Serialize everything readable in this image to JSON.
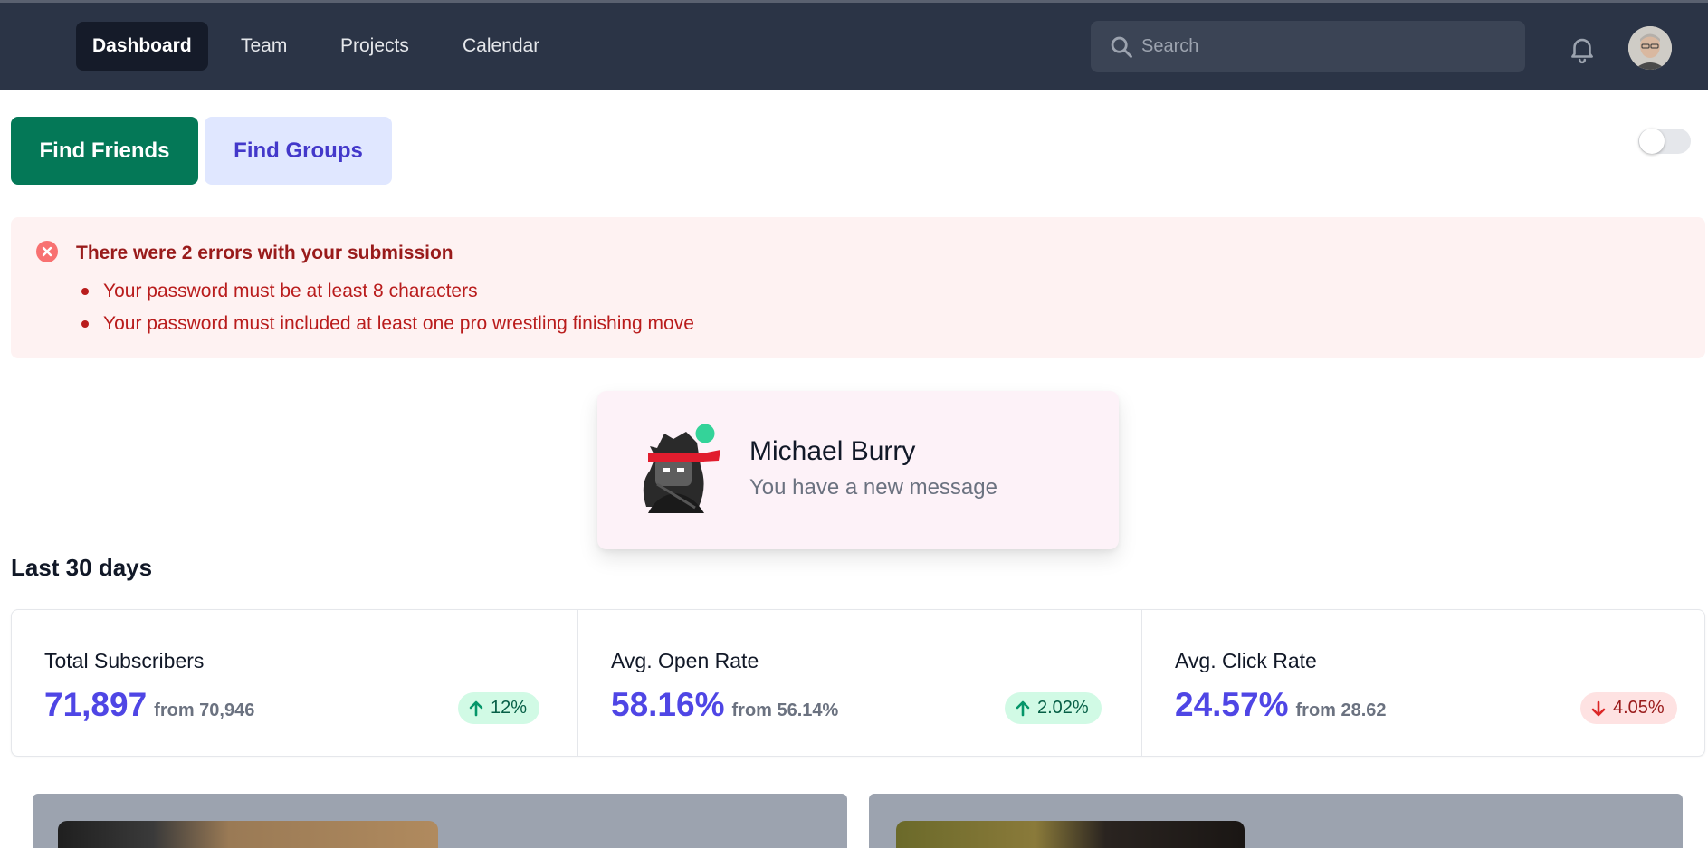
{
  "nav": {
    "links": [
      {
        "label": "Dashboard",
        "active": true
      },
      {
        "label": "Team",
        "active": false
      },
      {
        "label": "Projects",
        "active": false
      },
      {
        "label": "Calendar",
        "active": false
      }
    ],
    "search_placeholder": "Search",
    "icons": [
      "search-icon",
      "bell-icon",
      "user-avatar"
    ]
  },
  "actions": {
    "find_friends": "Find Friends",
    "find_groups": "Find Groups",
    "toggle_on": false
  },
  "alert": {
    "title": "There were 2 errors with your submission",
    "items": [
      "Your password must be at least 8 characters",
      "Your password must included at least one pro wrestling finishing move"
    ]
  },
  "notification": {
    "name": "Michael Burry",
    "message": "You have a new message",
    "online": true
  },
  "stats": {
    "title": "Last 30 days",
    "items": [
      {
        "label": "Total Subscribers",
        "value": "71,897",
        "from": "from 70,946",
        "change": "12%",
        "direction": "up"
      },
      {
        "label": "Avg. Open Rate",
        "value": "58.16%",
        "from": "from 56.14%",
        "change": "2.02%",
        "direction": "up"
      },
      {
        "label": "Avg. Click Rate",
        "value": "24.57%",
        "from": "from 28.62",
        "change": "4.05%",
        "direction": "down"
      }
    ]
  },
  "colors": {
    "nav_bg": "#2b3446",
    "primary_green": "#047857",
    "indigo": "#4f46e5",
    "alert_bg": "#fef2f2",
    "alert_text": "#991b1b"
  }
}
